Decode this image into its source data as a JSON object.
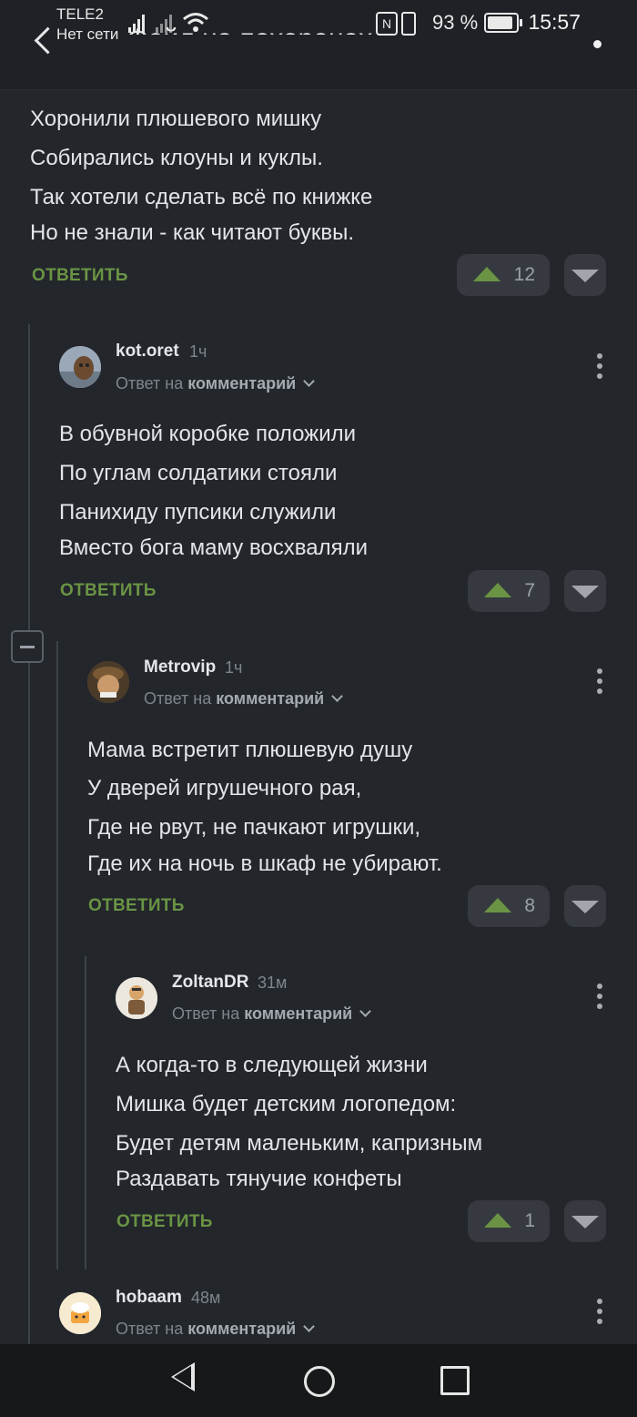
{
  "status_bar": {
    "carrier": "TELE2",
    "network": "Нет сети",
    "battery": "93 %",
    "time": "15:57"
  },
  "header": {
    "title": "Фейл на похоронах"
  },
  "root_comment": {
    "lines": [
      "Хоронили плюшевого мишку",
      "Собирались клоуны и куклы.",
      "Так хотели сделать всё по книжке",
      "Но не знали - как читают буквы."
    ],
    "reply_label": "ОТВЕТИТЬ",
    "votes": "12"
  },
  "comments": [
    {
      "author": "kot.oret",
      "ago": "1ч",
      "reply_prefix": "Ответ на",
      "reply_target": "комментарий",
      "lines": [
        "В обувной коробке положили",
        "По углам солдатики стояли",
        "Панихиду пупсики служили",
        "Вместо бога маму восхваляли"
      ],
      "reply_label": "ОТВЕТИТЬ",
      "votes": "7"
    },
    {
      "author": "Metrovip",
      "ago": "1ч",
      "reply_prefix": "Ответ на",
      "reply_target": "комментарий",
      "lines": [
        "Мама встретит плюшевую душу",
        "У дверей игрушечного рая,",
        "Где не рвут, не пачкают игрушки,",
        "Где их на ночь в шкаф не убирают."
      ],
      "reply_label": "ОТВЕТИТЬ",
      "votes": "8"
    },
    {
      "author": "ZoltanDR",
      "ago": "31м",
      "reply_prefix": "Ответ на",
      "reply_target": "комментарий",
      "lines": [
        "А когда-то в следующей жизни",
        "Мишка будет детским логопедом:",
        "Будет детям маленьким, капризным",
        "Раздавать тянучие конфеты"
      ],
      "reply_label": "ОТВЕТИТЬ",
      "votes": "1"
    },
    {
      "author": "hobaam",
      "ago": "48м",
      "reply_prefix": "Ответ на",
      "reply_target": "комментарий"
    }
  ],
  "colors": {
    "background": "#23262b",
    "accent_green": "#6a9444",
    "vote_button": "#363a40"
  },
  "icons": [
    "back-arrow-icon",
    "more-icon",
    "upvote-icon",
    "downvote-icon",
    "chevron-down-icon",
    "collapse-icon",
    "nav-back-icon",
    "nav-home-icon",
    "nav-recent-icon"
  ]
}
